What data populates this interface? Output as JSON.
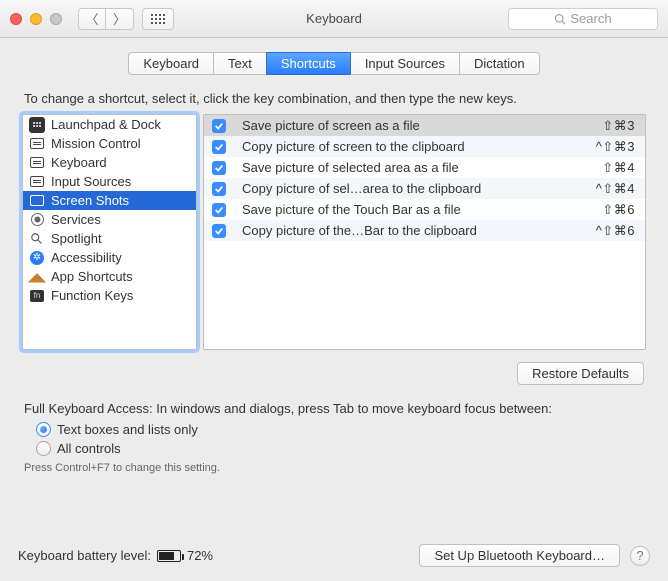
{
  "window": {
    "title": "Keyboard",
    "search_placeholder": "Search"
  },
  "tabs": [
    "Keyboard",
    "Text",
    "Shortcuts",
    "Input Sources",
    "Dictation"
  ],
  "tabs_selected": 2,
  "instruction": "To change a shortcut, select it, click the key combination, and then type the new keys.",
  "categories": [
    {
      "label": "Launchpad & Dock",
      "icon": "launchpad"
    },
    {
      "label": "Mission Control",
      "icon": "mission"
    },
    {
      "label": "Keyboard",
      "icon": "keyboard"
    },
    {
      "label": "Input Sources",
      "icon": "input"
    },
    {
      "label": "Screen Shots",
      "icon": "screenshots",
      "selected": true
    },
    {
      "label": "Services",
      "icon": "services"
    },
    {
      "label": "Spotlight",
      "icon": "spotlight"
    },
    {
      "label": "Accessibility",
      "icon": "accessibility"
    },
    {
      "label": "App Shortcuts",
      "icon": "apps"
    },
    {
      "label": "Function Keys",
      "icon": "fn"
    }
  ],
  "shortcuts": [
    {
      "checked": true,
      "label": "Save picture of screen as a file",
      "keys": "⇧⌘3",
      "selected": true
    },
    {
      "checked": true,
      "label": "Copy picture of screen to the clipboard",
      "keys": "^⇧⌘3"
    },
    {
      "checked": true,
      "label": "Save picture of selected area as a file",
      "keys": "⇧⌘4"
    },
    {
      "checked": true,
      "label": "Copy picture of sel…area to the clipboard",
      "keys": "^⇧⌘4"
    },
    {
      "checked": true,
      "label": "Save picture of the Touch Bar as a file",
      "keys": "⇧⌘6"
    },
    {
      "checked": true,
      "label": "Copy picture of the…Bar to the clipboard",
      "keys": "^⇧⌘6"
    }
  ],
  "restore": "Restore Defaults",
  "fka": {
    "prompt": "Full Keyboard Access: In windows and dialogs, press Tab to move keyboard focus between:",
    "opt1": "Text boxes and lists only",
    "opt2": "All controls",
    "hint": "Press Control+F7 to change this setting."
  },
  "footer": {
    "battery_label": "Keyboard battery level:",
    "battery_pct": "72%",
    "bt_button": "Set Up Bluetooth Keyboard…"
  }
}
